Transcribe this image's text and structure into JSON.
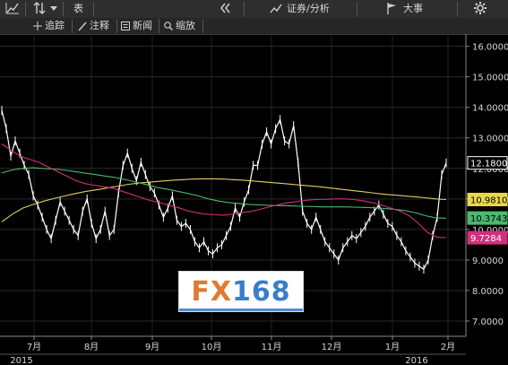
{
  "toolbar": {
    "row1": {
      "chart_type_icon": "line-chart-icon",
      "compare_icon": "up-down-arrows-icon",
      "dropdown_icon": "chevron-down-icon",
      "table_label": "表",
      "collapse_icon": "double-left-arrow-icon",
      "securities_label": "证券/分析",
      "events_label": "大事",
      "settings_icon": "gear-icon"
    },
    "row2": {
      "track_label": "追踪",
      "annotate_label": "注释",
      "news_label": "新闻",
      "zoom_label": "缩放"
    }
  },
  "chart_data": {
    "type": "line",
    "x_labels": [
      "7月",
      "8月",
      "9月",
      "10月",
      "11月",
      "12月",
      "1月",
      "2月"
    ],
    "year_labels": [
      "2015",
      "2016"
    ],
    "y_ticks": [
      "16.0000",
      "15.0000",
      "14.0000",
      "13.0000",
      "12.0000",
      "11.0000",
      "10.0000",
      "9.0000",
      "8.0000",
      "7.0000"
    ],
    "ylim": [
      6.5,
      16.4
    ],
    "series": [
      {
        "name": "",
        "color": "#ffffff",
        "values": [
          13.9,
          13.3,
          12.4,
          12.9,
          12.5,
          12.1,
          11.8,
          11.1,
          10.8,
          10.4,
          10.0,
          9.7,
          10.3,
          10.9,
          10.6,
          10.3,
          10.0,
          9.8,
          10.6,
          11.0,
          10.2,
          9.7,
          10.0,
          10.6,
          9.8,
          10.0,
          11.2,
          12.1,
          12.5,
          12.0,
          11.6,
          12.2,
          11.8,
          11.4,
          11.2,
          10.8,
          10.4,
          10.7,
          11.1,
          10.3,
          10.1,
          10.2,
          10.0,
          9.6,
          9.4,
          9.6,
          9.3,
          9.2,
          9.4,
          9.5,
          9.8,
          10.1,
          10.7,
          10.4,
          10.9,
          11.3,
          12.1,
          12.1,
          12.8,
          13.2,
          12.8,
          13.3,
          13.6,
          12.9,
          12.8,
          13.4,
          12.2,
          10.6,
          10.2,
          10.0,
          10.4,
          10.0,
          9.6,
          9.4,
          9.2,
          9.0,
          9.4,
          9.6,
          9.8,
          9.7,
          9.9,
          10.1,
          10.4,
          10.6,
          10.8,
          10.5,
          10.2,
          10.1,
          9.8,
          9.6,
          9.3,
          9.1,
          8.9,
          8.8,
          8.7,
          9.0,
          9.8,
          10.4,
          11.8,
          12.18
        ]
      },
      {
        "name": "",
        "color": "#e0d060",
        "values": [
          10.25,
          10.5,
          10.7,
          10.82,
          10.93,
          11.02,
          11.1,
          11.18,
          11.25,
          11.3,
          11.36,
          11.42,
          11.48,
          11.52,
          11.55,
          11.58,
          11.61,
          11.63,
          11.65,
          11.66,
          11.66,
          11.65,
          11.63,
          11.61,
          11.58,
          11.55,
          11.52,
          11.49,
          11.46,
          11.43,
          11.4,
          11.36,
          11.32,
          11.28,
          11.24,
          11.2,
          11.16,
          11.13,
          11.1,
          11.07,
          11.04,
          11.0,
          10.98
        ]
      },
      {
        "name": "",
        "color": "#4db870",
        "values": [
          11.85,
          11.95,
          12.0,
          12.02,
          12.0,
          11.98,
          11.95,
          11.9,
          11.85,
          11.8,
          11.75,
          11.7,
          11.63,
          11.55,
          11.47,
          11.38,
          11.32,
          11.25,
          11.18,
          11.1,
          11.0,
          10.93,
          10.88,
          10.85,
          10.82,
          10.8,
          10.79,
          10.78,
          10.77,
          10.76,
          10.75,
          10.74,
          10.74,
          10.74,
          10.73,
          10.72,
          10.71,
          10.69,
          10.66,
          10.62,
          10.55,
          10.45,
          10.38,
          10.37
        ]
      },
      {
        "name": "",
        "color": "#d0307a",
        "values": [
          12.8,
          12.6,
          12.4,
          12.3,
          12.2,
          12.05,
          11.9,
          11.75,
          11.6,
          11.5,
          11.45,
          11.4,
          11.35,
          11.25,
          11.15,
          11.05,
          10.95,
          10.88,
          10.8,
          10.72,
          10.62,
          10.55,
          10.5,
          10.48,
          10.47,
          10.5,
          10.55,
          10.6,
          10.67,
          10.75,
          10.82,
          10.88,
          10.92,
          10.96,
          10.98,
          10.99,
          11.0,
          11.0,
          10.98,
          10.94,
          10.88,
          10.8,
          10.7,
          10.6,
          10.45,
          10.2,
          9.9,
          9.75,
          9.73
        ]
      }
    ],
    "last_values": [
      {
        "label": "12.1800",
        "value": 12.18,
        "bg": "#000000",
        "fg": "#ffffff",
        "border": "#ffffff"
      },
      {
        "label": "10.9810",
        "value": 10.981,
        "bg": "#e8d84c",
        "fg": "#000000",
        "border": "#e8d84c"
      },
      {
        "label": "10.3743",
        "value": 10.3743,
        "bg": "#4db870",
        "fg": "#000000",
        "border": "#4db870"
      },
      {
        "label": "9.7284",
        "value": 9.7284,
        "bg": "#d42f7c",
        "fg": "#ffffff",
        "border": "#d42f7c"
      }
    ],
    "grid": true
  },
  "watermark": {
    "part1": "FX",
    "part2": "168"
  }
}
